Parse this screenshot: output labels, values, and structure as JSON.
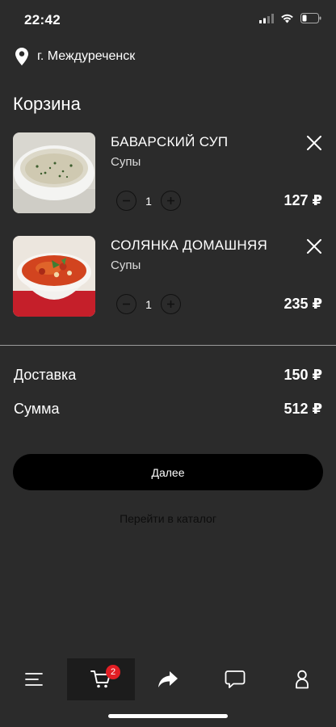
{
  "status_bar": {
    "time": "22:42"
  },
  "location": {
    "icon": "map-pin-icon",
    "city": "г. Междуреченск"
  },
  "cart": {
    "title": "Корзина",
    "items": [
      {
        "name": "БАВАРСКИЙ СУП",
        "category": "Супы",
        "quantity": "1",
        "price": "127 ₽",
        "image": "bavarian-soup-photo"
      },
      {
        "name": "СОЛЯНКА ДОМАШНЯЯ",
        "category": "Супы",
        "quantity": "1",
        "price": "235 ₽",
        "image": "solyanka-photo"
      }
    ]
  },
  "summary": {
    "delivery_label": "Доставка",
    "delivery_value": "150 ₽",
    "total_label": "Сумма",
    "total_value": "512 ₽"
  },
  "actions": {
    "next_label": "Далее",
    "catalog_label": "Перейти в каталог"
  },
  "tabbar": {
    "cart_badge": "2",
    "tabs": [
      "menu-icon",
      "cart-icon",
      "share-icon",
      "chat-icon",
      "profile-icon"
    ]
  },
  "colors": {
    "background": "#2b2b2b",
    "button": "#000000",
    "badge": "#e31e24"
  }
}
